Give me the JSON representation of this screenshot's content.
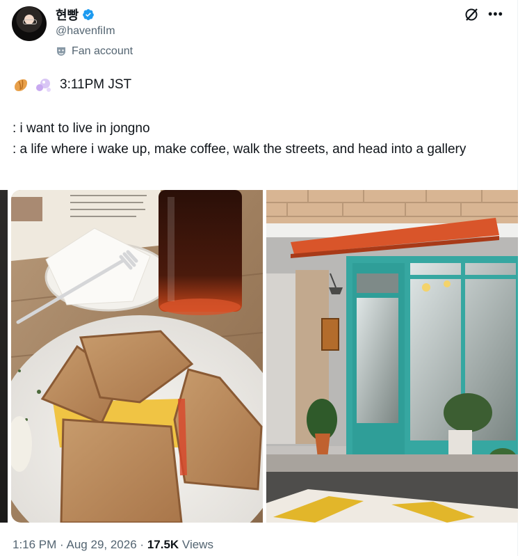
{
  "author": {
    "display_name": "현빵",
    "handle": "@havenfiIm",
    "label": "Fan account"
  },
  "tweet": {
    "time_line": "3:11PM JST",
    "lines": [
      ": i want to live in jongno",
      ": a life where i wake up, make coffee, walk the streets, and head into a gallery"
    ]
  },
  "footer": {
    "time": "1:16 PM",
    "date": "Aug 29, 2026",
    "views_count": "17.5K",
    "views_label": "Views",
    "separator": "·"
  },
  "icons": {
    "verified": "verified-badge-icon",
    "label": "fan-account-mask-icon",
    "grok": "slash-circle-icon",
    "more": "more-horizontal-icon"
  },
  "colors": {
    "verified_blue": "#1d9bf0",
    "secondary_text": "#536471",
    "primary_text": "#0f1419"
  }
}
